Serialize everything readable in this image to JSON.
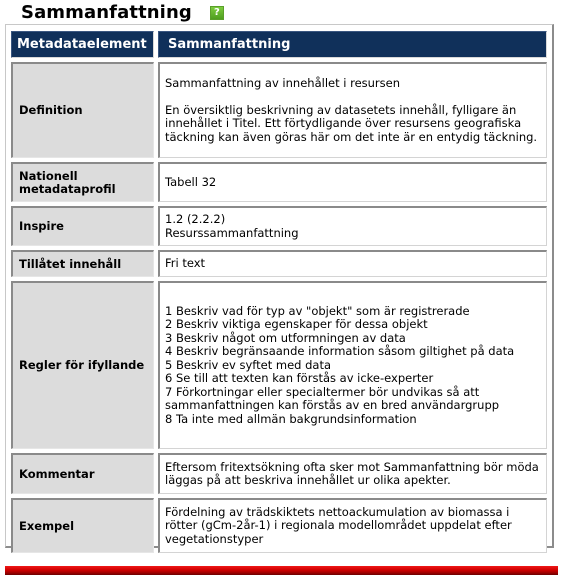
{
  "heading": {
    "title": "Sammanfattning",
    "help_icon": "help-icon",
    "help_glyph": "?",
    "help_color": "#5fb02a"
  },
  "table": {
    "header": {
      "col_label": "Metadataelement",
      "col_value": "Sammanfattning",
      "background": "#10305a"
    },
    "rows": [
      {
        "label": "Definition",
        "value_lines": [
          "Sammanfattning av innehållet i resursen",
          "En översiktlig beskrivning av datasetets innehåll, fylligare än innehållet i Titel. Ett förtydligande över resursens geografiska täckning kan även göras här om det inte är en entydig täckning."
        ]
      },
      {
        "label": "Nationell metadataprofil",
        "value_lines": [
          "Tabell 32"
        ]
      },
      {
        "label": "Inspire",
        "value_lines": [
          "1.2 (2.2.2)",
          "Resurssammanfattning"
        ]
      },
      {
        "label": "Tillåtet innehåll",
        "value_lines": [
          "Fri text"
        ]
      },
      {
        "label": "Regler för ifyllande",
        "value_lines": [
          "1 Beskriv vad för typ av \"objekt\" som är registrerade",
          "2 Beskriv viktiga egenskaper för dessa objekt",
          "3 Beskriv något om utformningen av data",
          "4 Beskriv begränsaande information såsom giltighet på data",
          "5 Beskriv ev syftet med data",
          "6 Se till att texten kan förstås av icke-experter",
          "7 Förkortningar eller specialtermer bör undvikas så att sammanfattningen kan förstås av en bred användargrupp",
          "8 Ta inte med allmän bakgrundsinformation"
        ]
      },
      {
        "label": "Kommentar",
        "value_lines": [
          "Eftersom fritextsökning ofta sker mot Sammanfattning bör möda läggas på att beskriva innehållet ur olika apekter."
        ]
      },
      {
        "label": "Exempel",
        "value_lines": [
          "Fördelning av trädskiktets nettoackumulation av biomassa i rötter (gCm-2år-1) i regionala modellområdet uppdelat efter vegetationstyper"
        ]
      }
    ]
  },
  "footer": {
    "bar_color": "#d00000"
  }
}
